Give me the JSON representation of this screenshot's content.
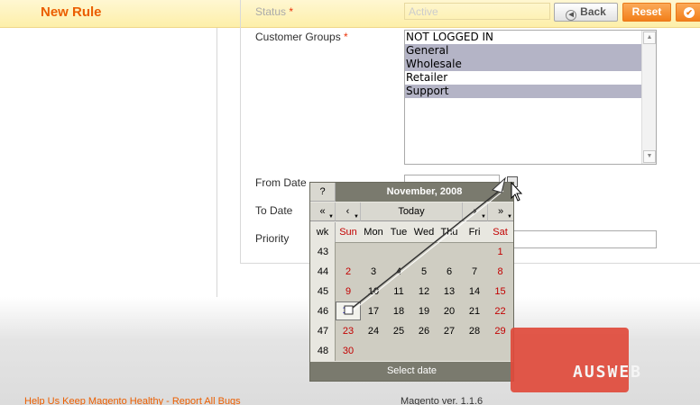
{
  "header": {
    "title": "New Rule",
    "back_label": "Back",
    "reset_label": "Reset"
  },
  "form": {
    "status_label": "Status",
    "status_value": "Active",
    "customer_groups_label": "Customer Groups",
    "required_mark": "*",
    "customer_groups": [
      {
        "label": "NOT LOGGED IN",
        "selected": false
      },
      {
        "label": "General",
        "selected": true
      },
      {
        "label": "Wholesale",
        "selected": true
      },
      {
        "label": "Retailer",
        "selected": false
      },
      {
        "label": "Support",
        "selected": true
      }
    ],
    "from_date_label": "From Date",
    "to_date_label": "To Date",
    "priority_label": "Priority"
  },
  "calendar": {
    "help_label": "?",
    "month_title": "November, 2008",
    "prev_year_label": "«",
    "prev_month_label": "‹",
    "today_label": "Today",
    "next_month_label": "›",
    "next_year_label": "»",
    "headers": [
      "wk",
      "Sun",
      "Mon",
      "Tue",
      "Wed",
      "Thu",
      "Fri",
      "Sat"
    ],
    "weeks": [
      {
        "wk": "43",
        "days": [
          "",
          "",
          "",
          "",
          "",
          "",
          "1"
        ]
      },
      {
        "wk": "44",
        "days": [
          "2",
          "3",
          "4",
          "5",
          "6",
          "7",
          "8"
        ]
      },
      {
        "wk": "45",
        "days": [
          "9",
          "10",
          "11",
          "12",
          "13",
          "14",
          "15"
        ]
      },
      {
        "wk": "46",
        "days": [
          "16",
          "17",
          "18",
          "19",
          "20",
          "21",
          "22"
        ]
      },
      {
        "wk": "47",
        "days": [
          "23",
          "24",
          "25",
          "26",
          "27",
          "28",
          "29"
        ]
      },
      {
        "wk": "48",
        "days": [
          "30",
          "",
          "",
          "",
          "",
          "",
          ""
        ]
      }
    ],
    "today_day": "16",
    "footer_label": "Select date"
  },
  "footer": {
    "link_text": "Help Us Keep Magento Healthy - Report All Bugs",
    "version_text": "Magento ver. 1.1.6"
  },
  "watermark": {
    "text": "AUSWEB"
  },
  "colors": {
    "accent": "#eb5e00",
    "button_orange": "#f27f1a",
    "selected_option": "#b4b4c6",
    "weekend_red": "#c20000",
    "calendar_header": "#7a7a6e"
  }
}
